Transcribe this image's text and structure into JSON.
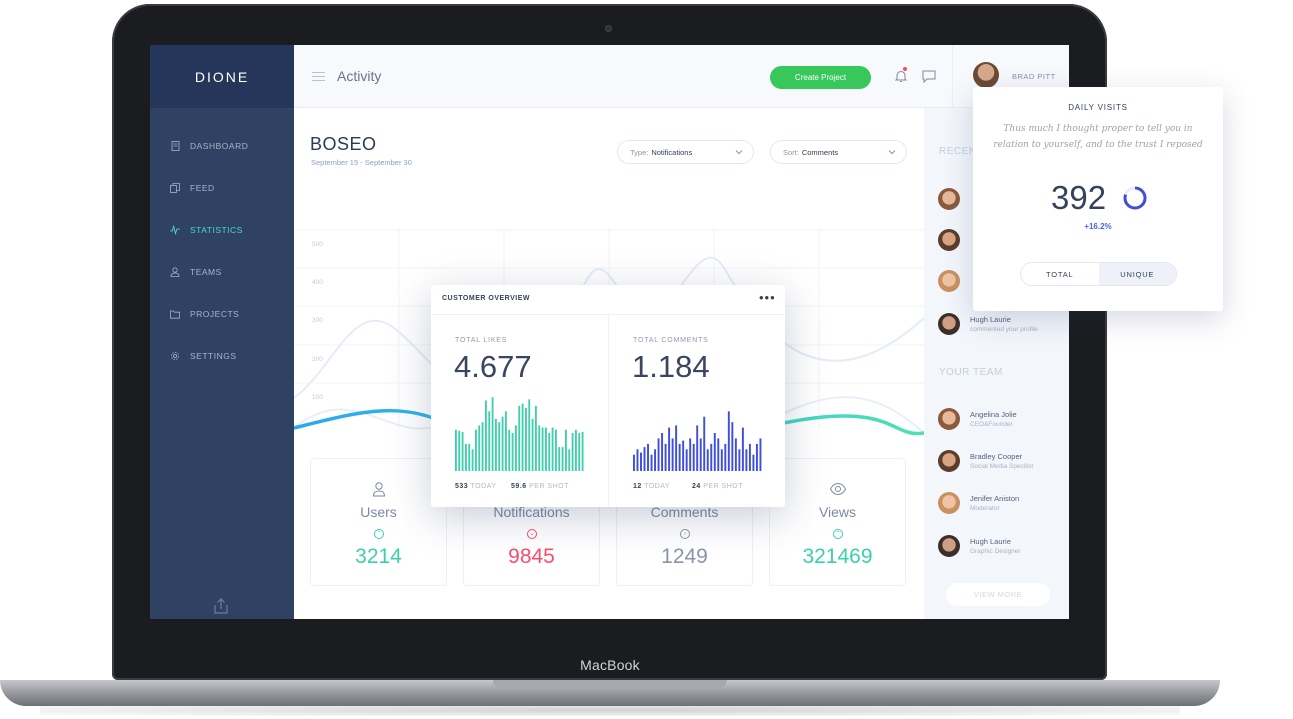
{
  "laptop": {
    "brand": "MacBook"
  },
  "sidebar": {
    "logo": "DIONE",
    "items": [
      {
        "label": "DASHBOARD",
        "icon": "document-icon"
      },
      {
        "label": "FEED",
        "icon": "copy-icon"
      },
      {
        "label": "STATISTICS",
        "icon": "activity-icon",
        "active": true
      },
      {
        "label": "TEAMS",
        "icon": "user-icon"
      },
      {
        "label": "PROJECTS",
        "icon": "folder-icon"
      },
      {
        "label": "SETTINGS",
        "icon": "gear-icon"
      }
    ]
  },
  "topbar": {
    "title": "Activity",
    "create_label": "Create Project",
    "user_name": "BRAD PITT"
  },
  "main": {
    "project_title": "BOSEO",
    "dates": "September 15 - September 30",
    "type_select": {
      "prefix": "Type:",
      "value": "Notifications"
    },
    "sort_select": {
      "prefix": "Sort:",
      "value": "Comments"
    },
    "y_ticks": [
      "500",
      "400",
      "300",
      "200",
      "100"
    ],
    "stats": [
      {
        "label": "Users",
        "value": "3214",
        "color": "#3ccfab",
        "icon": "user-icon"
      },
      {
        "label": "Notifications",
        "value": "9845",
        "color": "#ff4b6e",
        "icon": "bell-icon"
      },
      {
        "label": "Comments",
        "value": "1249",
        "color": "#8b96aa",
        "icon": "chat-icon"
      },
      {
        "label": "Views",
        "value": "321469",
        "color": "#3ccfab",
        "icon": "eye-icon"
      }
    ]
  },
  "right_panel": {
    "recent_heading": "RECENT",
    "recent": [
      {
        "name": "",
        "desc": ""
      },
      {
        "name": "",
        "desc": ""
      },
      {
        "name": "",
        "desc": ""
      },
      {
        "name": "Hugh Laurie",
        "desc": "commented your profile"
      }
    ],
    "team_heading": "YOUR TEAM",
    "team": [
      {
        "name": "Angelina Jolie",
        "role": "CEO&Founder"
      },
      {
        "name": "Bradley Cooper",
        "role": "Social Media Specilist"
      },
      {
        "name": "Jenifer Aniston",
        "role": "Moderator"
      },
      {
        "name": "Hugh Laurie",
        "role": "Graphic Designer"
      }
    ],
    "view_more": "VIEW MORE"
  },
  "overview": {
    "title": "CUSTOMER OVERVIEW",
    "more": "•••",
    "likes": {
      "label": "TOTAL LIKES",
      "value": "4.677",
      "today": "533",
      "today_label": "TODAY",
      "per_shot": "59.6",
      "per_shot_label": "PER SHOT",
      "color": "#3ccfab"
    },
    "comments": {
      "label": "TOTAL COMMENTS",
      "value": "1.184",
      "today": "12",
      "today_label": "TODAY",
      "per_shot": "24",
      "per_shot_label": "PER SHOT",
      "color": "#3f4fd9"
    }
  },
  "daily_visits": {
    "title": "DAILY VISITS",
    "description": "Thus much I thought proper to tell you in relation to yourself, and to the trust I reposed",
    "value": "392",
    "change": "+16.2%",
    "ring_fraction": 0.8,
    "toggle": [
      "TOTAL",
      "UNIQUE"
    ],
    "selected": "UNIQUE"
  },
  "chart_data": [
    {
      "type": "bar",
      "title": "TOTAL LIKES",
      "values": [
        38,
        37,
        36,
        25,
        25,
        20,
        38,
        42,
        45,
        65,
        55,
        68,
        48,
        45,
        50,
        55,
        38,
        35,
        42,
        60,
        62,
        58,
        66,
        48,
        60,
        42,
        40,
        40,
        35,
        40,
        38,
        22,
        22,
        38,
        20,
        35,
        38,
        35,
        36
      ]
    },
    {
      "type": "bar",
      "title": "TOTAL COMMENTS",
      "values": [
        15,
        20,
        17,
        22,
        25,
        15,
        20,
        30,
        35,
        25,
        40,
        30,
        42,
        25,
        28,
        20,
        30,
        25,
        42,
        30,
        50,
        20,
        25,
        35,
        30,
        20,
        25,
        55,
        45,
        30,
        20,
        40,
        20,
        25,
        15,
        25,
        30
      ]
    }
  ]
}
